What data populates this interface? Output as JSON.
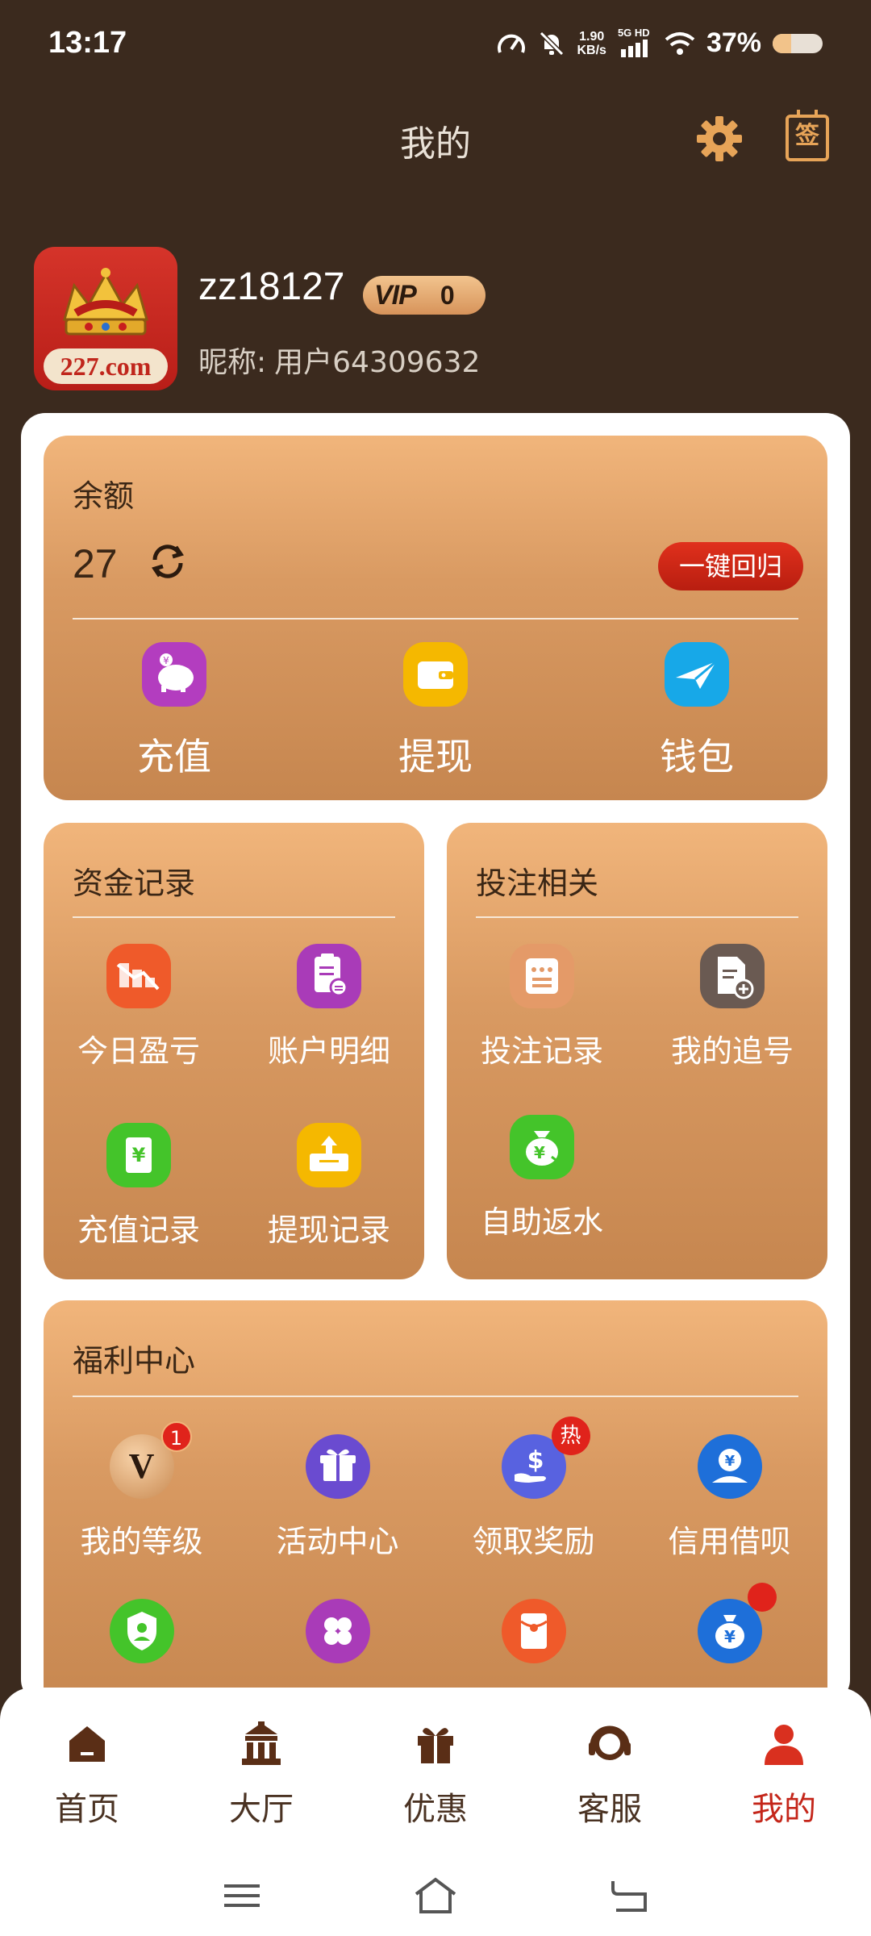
{
  "status_bar": {
    "time": "13:17",
    "net_speed_value": "1.90",
    "net_speed_unit": "KB/s",
    "network": "5G HD",
    "battery": "37%",
    "battery_level": 0.37
  },
  "header": {
    "title": "我的",
    "settings_icon": "gear-icon",
    "sign_label": "签"
  },
  "profile": {
    "site_logo_text": "227.com",
    "username": "zz18127",
    "vip_label": "VIP",
    "vip_level": "0",
    "nickname_label": "昵称:",
    "nickname": "用户64309632"
  },
  "balance": {
    "title": "余额",
    "amount": "27",
    "return_button": "一键回归",
    "actions": [
      {
        "label": "充值",
        "icon": "piggy-bank-icon",
        "color": "#b33dbf"
      },
      {
        "label": "提现",
        "icon": "wallet-icon",
        "color": "#f5b800"
      },
      {
        "label": "钱包",
        "icon": "paper-plane-icon",
        "color": "#17a8e8"
      }
    ]
  },
  "fund_records": {
    "title": "资金记录",
    "items": [
      {
        "label": "今日盈亏",
        "icon": "chart-down-icon",
        "color": "#ef5a2a"
      },
      {
        "label": "账户明细",
        "icon": "clipboard-icon",
        "color": "#a93bb8"
      },
      {
        "label": "充值记录",
        "icon": "yuan-card-icon",
        "color": "#44c42a"
      },
      {
        "label": "提现记录",
        "icon": "upload-box-icon",
        "color": "#f5b800"
      }
    ]
  },
  "bet_related": {
    "title": "投注相关",
    "items": [
      {
        "label": "投注记录",
        "icon": "list-icon",
        "color": "#e49a68"
      },
      {
        "label": "我的追号",
        "icon": "document-add-icon",
        "color": "#6a5a52"
      },
      {
        "label": "自助返水",
        "icon": "money-bag-icon",
        "color": "#44c42a"
      }
    ]
  },
  "welfare": {
    "title": "福利中心",
    "items": [
      {
        "label": "我的等级",
        "icon": "vip-level-icon",
        "color": "#d9a268",
        "badge": "1"
      },
      {
        "label": "活动中心",
        "icon": "gift-icon",
        "color": "#6a4bd0"
      },
      {
        "label": "领取奖励",
        "icon": "dollar-hand-icon",
        "color": "#5862e0",
        "badge": "热"
      },
      {
        "label": "信用借呗",
        "icon": "yuan-person-icon",
        "color": "#1e6fd9"
      }
    ],
    "row2_icons": [
      {
        "icon": "shield-user-icon",
        "color": "#44c42a"
      },
      {
        "icon": "clover-icon",
        "color": "#a93bb8"
      },
      {
        "icon": "red-envelope-icon",
        "color": "#ef5a2a"
      },
      {
        "icon": "yuan-bag-icon",
        "color": "#1e6fd9"
      }
    ]
  },
  "bottom_nav": {
    "items": [
      {
        "label": "首页",
        "icon": "home-icon"
      },
      {
        "label": "大厅",
        "icon": "hall-icon"
      },
      {
        "label": "优惠",
        "icon": "gift-icon"
      },
      {
        "label": "客服",
        "icon": "headset-icon"
      },
      {
        "label": "我的",
        "icon": "user-icon",
        "active": true
      }
    ]
  },
  "colors": {
    "background": "#3b2a1e",
    "accent": "#e7a458",
    "card_gradient_top": "#f1b57b",
    "card_gradient_bottom": "#c6864f",
    "active_nav": "#c4261a"
  }
}
